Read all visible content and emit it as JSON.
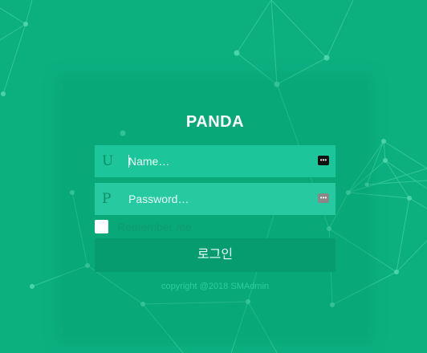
{
  "app": {
    "title": "PANDA"
  },
  "form": {
    "username": {
      "prefix": "U",
      "placeholder": "Name…",
      "value": ""
    },
    "password": {
      "prefix": "P",
      "placeholder": "Password…",
      "value": ""
    },
    "remember": {
      "label": "Remember me",
      "checked": false
    },
    "login_label": "로그인"
  },
  "footer": {
    "copyright": "copyright @2018 SMAdmin"
  },
  "colors": {
    "background": "#0cb07f",
    "field": "#27c9a0",
    "button": "#069c6f",
    "title": "#ffffff"
  },
  "icons": {
    "password_manager": "key-icon"
  }
}
